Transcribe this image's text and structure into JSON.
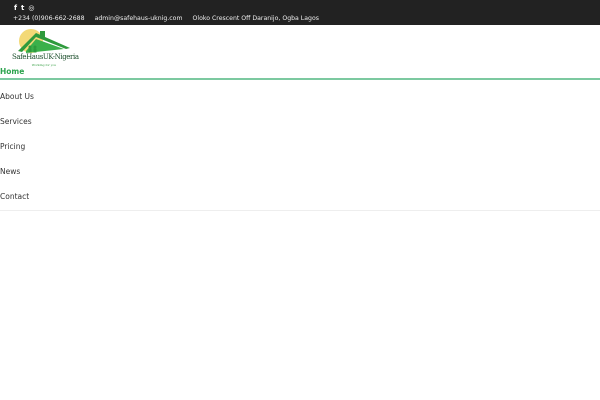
{
  "topbar": {
    "social": [
      {
        "icon": "facebook-icon",
        "glyph": "f"
      },
      {
        "icon": "twitter-icon",
        "glyph": "t"
      },
      {
        "icon": "instagram-icon",
        "glyph": "◎"
      }
    ],
    "phone": "+234 (0)906-662-2688",
    "email": "admin@safehaus-uknig.com",
    "address": "Oloko Crescent Off Daranijo, Ogba Lagos"
  },
  "logo": {
    "name": "SafeHausUK-Nigeria",
    "tagline": "Working for you"
  },
  "nav": {
    "items": [
      "Home",
      "About Us",
      "Services",
      "Pricing",
      "News",
      "Contact"
    ]
  }
}
